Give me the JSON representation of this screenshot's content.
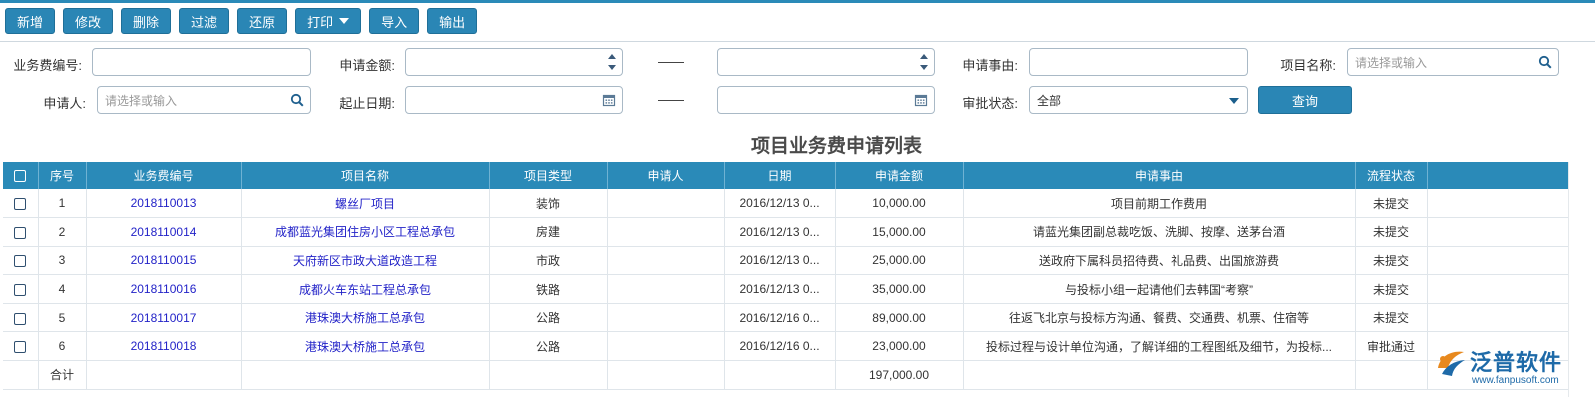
{
  "toolbar": {
    "buttons": [
      "新增",
      "修改",
      "删除",
      "过滤",
      "还原",
      "打印",
      "导入",
      "输出"
    ]
  },
  "filters": {
    "code_label": "业务费编号:",
    "code_value": "",
    "amount_label": "申请金额:",
    "amount_from": "",
    "amount_to": "",
    "reason_label": "申请事由:",
    "reason_value": "",
    "project_label": "项目名称:",
    "project_placeholder": "请选择或输入",
    "applicant_label": "申请人:",
    "applicant_placeholder": "请选择或输入",
    "date_label": "起止日期:",
    "date_from": "",
    "date_to": "",
    "status_label": "审批状态:",
    "status_value": "全部",
    "query_label": "查询"
  },
  "table": {
    "title": "项目业务费申请列表",
    "headers": [
      "序号",
      "业务费编号",
      "项目名称",
      "项目类型",
      "申请人",
      "日期",
      "申请金额",
      "申请事由",
      "流程状态"
    ],
    "rows": [
      {
        "no": "1",
        "code": "2018110013",
        "project": "螺丝厂项目",
        "type": "装饰",
        "applicant": "",
        "date": "2016/12/13 0...",
        "amount": "10,000.00",
        "reason": "项目前期工作费用",
        "status": "未提交"
      },
      {
        "no": "2",
        "code": "2018110014",
        "project": "成都蓝光集团住房小区工程总承包",
        "type": "房建",
        "applicant": "",
        "date": "2016/12/13 0...",
        "amount": "15,000.00",
        "reason": "请蓝光集团副总裁吃饭、洗脚、按摩、送茅台酒",
        "status": "未提交"
      },
      {
        "no": "3",
        "code": "2018110015",
        "project": "天府新区市政大道改造工程",
        "type": "市政",
        "applicant": "",
        "date": "2016/12/13 0...",
        "amount": "25,000.00",
        "reason": "送政府下属科员招待费、礼品费、出国旅游费",
        "status": "未提交"
      },
      {
        "no": "4",
        "code": "2018110016",
        "project": "成都火车东站工程总承包",
        "type": "铁路",
        "applicant": "",
        "date": "2016/12/13 0...",
        "amount": "35,000.00",
        "reason": "与投标小组一起请他们去韩国“考察”",
        "status": "未提交"
      },
      {
        "no": "5",
        "code": "2018110017",
        "project": "港珠澳大桥施工总承包",
        "type": "公路",
        "applicant": "",
        "date": "2016/12/16 0...",
        "amount": "89,000.00",
        "reason": "往返飞北京与投标方沟通、餐费、交通费、机票、住宿等",
        "status": "未提交"
      },
      {
        "no": "6",
        "code": "2018110018",
        "project": "港珠澳大桥施工总承包",
        "type": "公路",
        "applicant": "",
        "date": "2016/12/16 0...",
        "amount": "23,000.00",
        "reason": "投标过程与设计单位沟通，了解详细的工程图纸及细节，为投标...",
        "status": "审批通过"
      }
    ],
    "total_label": "合计",
    "total_amount": "197,000.00"
  },
  "logo": {
    "name": "泛普软件",
    "url": "www.fanpusoft.com"
  },
  "colors": {
    "accent": "#2a86b5",
    "header": "#2a8ab8",
    "link": "#2323c8"
  }
}
